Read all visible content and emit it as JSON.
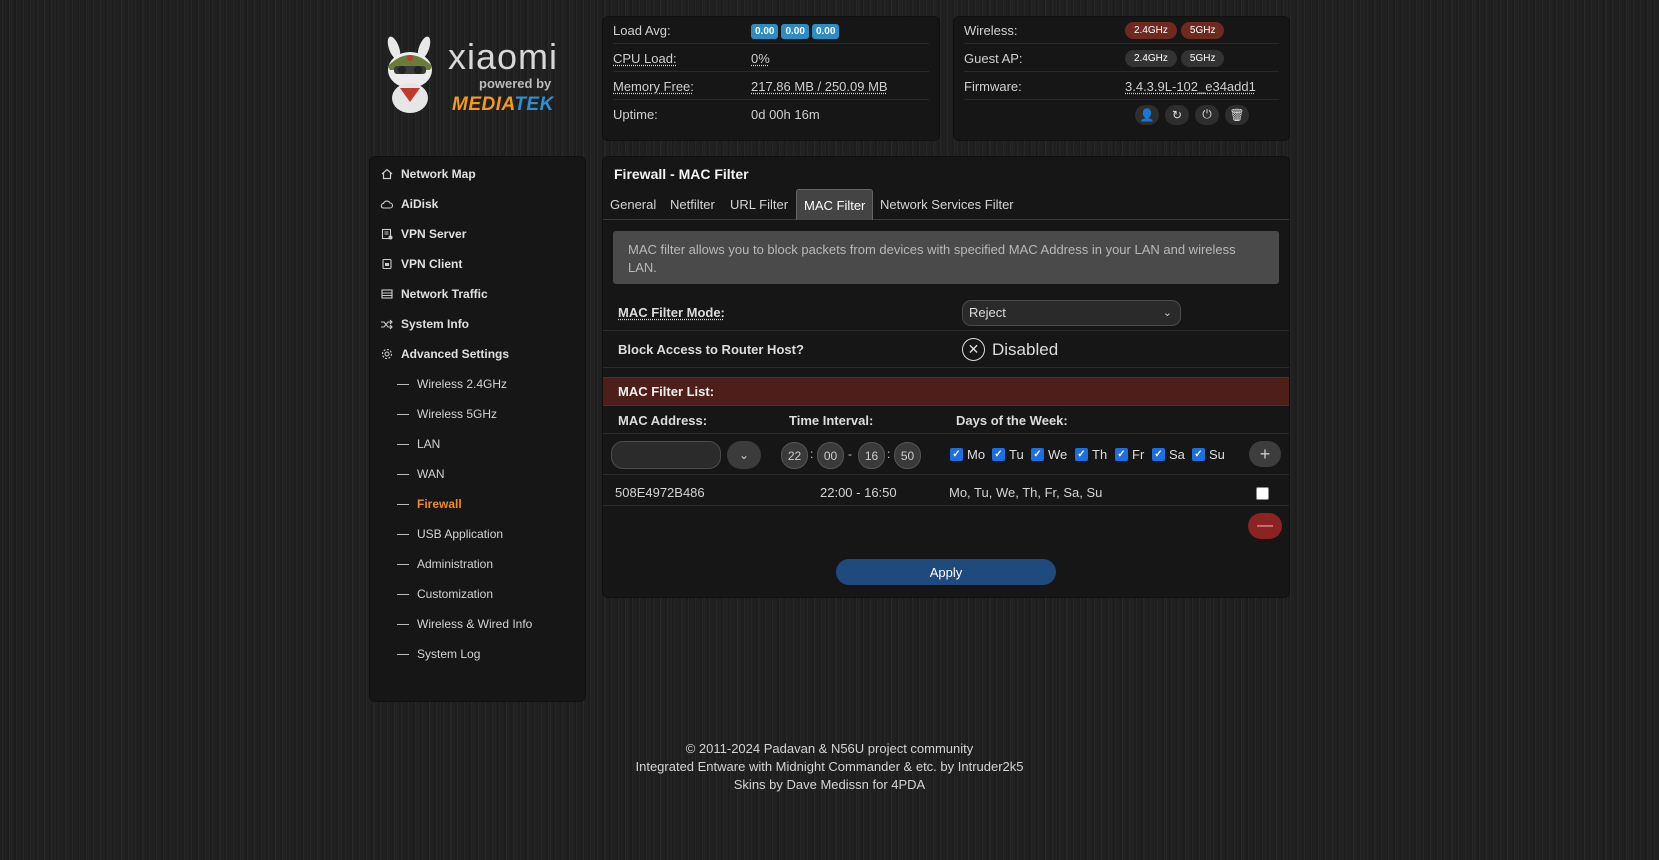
{
  "logo": {
    "brand": "xiaomi",
    "powered_by": "powered by",
    "chip_part1": "MEDIA",
    "chip_part2": "TEK"
  },
  "status": {
    "load_avg_label": "Load Avg:",
    "load_avg_values": [
      "0.00",
      "0.00",
      "0.00"
    ],
    "cpu_label": "CPU Load:",
    "cpu_value": "0%",
    "memory_label": "Memory Free:",
    "memory_value": "217.86 MB / 250.09 MB",
    "uptime_label": "Uptime:",
    "uptime_value": "0d 00h 16m"
  },
  "wireless_status": {
    "wireless_label": "Wireless:",
    "wireless_24": "2.4GHz",
    "wireless_5": "5GHz",
    "guest_label": "Guest AP:",
    "guest_24": "2.4GHz",
    "guest_5": "5GHz",
    "firmware_label": "Firmware:",
    "firmware_value": "3.4.3.9L-102_e34add1"
  },
  "sidebar": {
    "main_items": [
      {
        "label": "Network Map",
        "icon": "home-icon"
      },
      {
        "label": "AiDisk",
        "icon": "cloud-icon"
      },
      {
        "label": "VPN Server",
        "icon": "vpn-server-icon"
      },
      {
        "label": "VPN Client",
        "icon": "vpn-client-icon"
      },
      {
        "label": "Network Traffic",
        "icon": "traffic-icon"
      },
      {
        "label": "System Info",
        "icon": "shuffle-icon"
      },
      {
        "label": "Advanced Settings",
        "icon": "gear-icon"
      }
    ],
    "sub_items": [
      "Wireless 2.4GHz",
      "Wireless 5GHz",
      "LAN",
      "WAN",
      "Firewall",
      "USB Application",
      "Administration",
      "Customization",
      "Wireless & Wired Info",
      "System Log"
    ]
  },
  "main": {
    "title": "Firewall - MAC Filter",
    "tabs": [
      "General",
      "Netfilter",
      "URL Filter",
      "MAC Filter",
      "Network Services Filter"
    ],
    "active_tab": "MAC Filter",
    "info": "MAC filter allows you to block packets from devices with specified MAC Address in your LAN and wireless LAN.",
    "mode_label": "MAC Filter Mode:",
    "mode_value": "Reject",
    "block_label": "Block Access to Router Host?",
    "block_value": "Disabled",
    "list_title": "MAC Filter List:",
    "col_mac": "MAC Address:",
    "col_time": "Time Interval:",
    "col_days": "Days of the Week:",
    "time": {
      "h1": "22",
      "m1": "00",
      "h2": "16",
      "m2": "50",
      "sep_colon": ":",
      "sep_dash": "-"
    },
    "days": [
      "Mo",
      "Tu",
      "We",
      "Th",
      "Fr",
      "Sa",
      "Su"
    ],
    "rows": [
      {
        "mac": "508E4972B486",
        "interval": "22:00 - 16:50",
        "days": "Mo, Tu, We, Th, Fr, Sa, Su"
      }
    ],
    "apply_label": "Apply"
  },
  "footer": {
    "line1": "© 2011-2024 Padavan & N56U project community",
    "line2": "Integrated Entware with Midnight Commander & etc. by Intruder2k5",
    "line3": "Skins by Dave Medissn for 4PDA"
  },
  "colors": {
    "accent_orange": "#f08a1e",
    "badge_blue": "#2e8cc0",
    "list_header_red": "#4e1f1a",
    "apply_blue": "#1e4a7d"
  }
}
